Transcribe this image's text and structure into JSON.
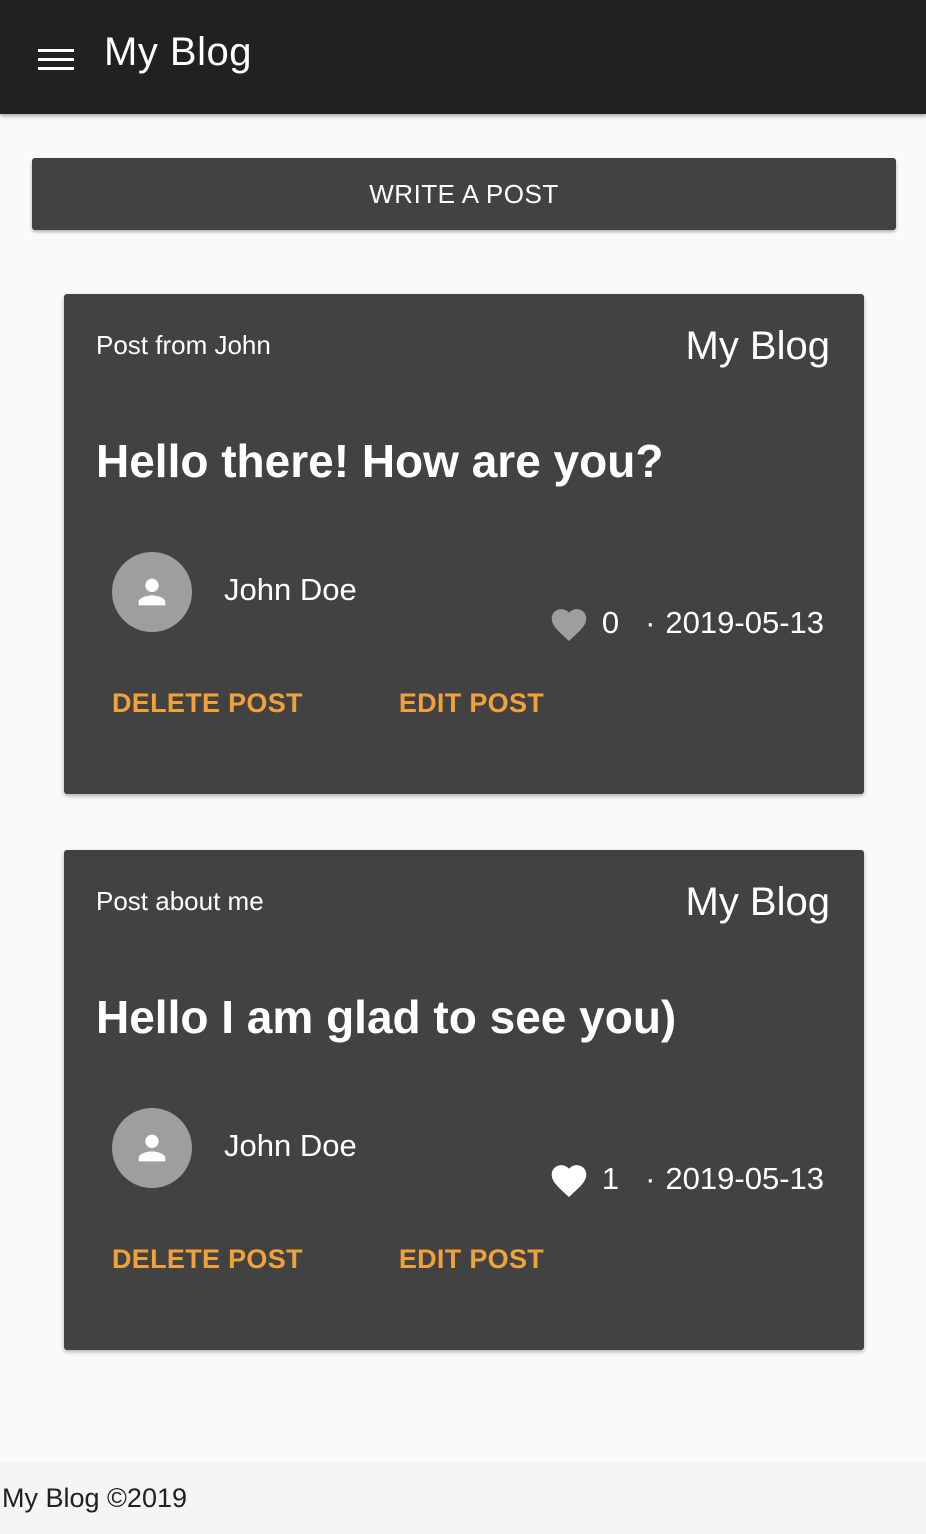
{
  "app": {
    "title": "My Blog"
  },
  "write_button": "WRITE A POST",
  "posts": [
    {
      "subtitle": "Post from John",
      "brand": "My Blog",
      "title": "Hello there! How are you?",
      "author": "John Doe",
      "likes": "0",
      "liked": false,
      "date": "2019-05-13",
      "delete_label": "DELETE POST",
      "edit_label": "EDIT POST"
    },
    {
      "subtitle": "Post about me",
      "brand": "My Blog",
      "title": "Hello I am glad to see you)",
      "author": "John Doe",
      "likes": "1",
      "liked": true,
      "date": "2019-05-13",
      "delete_label": "DELETE POST",
      "edit_label": "EDIT POST"
    }
  ],
  "footer": {
    "text": "My Blog ©2019"
  },
  "colors": {
    "appbar": "#212121",
    "card": "#424242",
    "accent": "#f0a139",
    "avatar": "#9e9e9e",
    "heart_unliked": "#9e9e9e",
    "heart_liked": "#ffffff"
  },
  "icons": {
    "menu": "menu-icon",
    "avatar": "person-icon",
    "like": "heart-icon"
  }
}
